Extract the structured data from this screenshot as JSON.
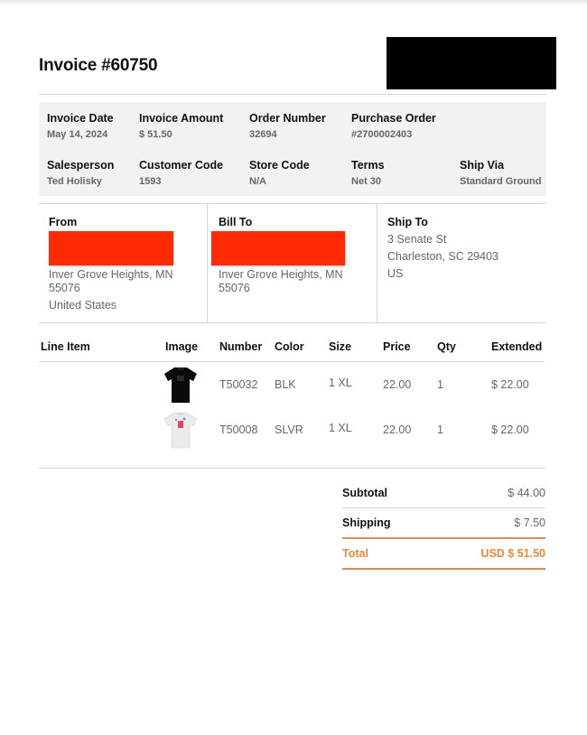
{
  "invoice": {
    "title": "Invoice #60750"
  },
  "meta": {
    "row1": [
      {
        "label": "Invoice Date",
        "value": "May 14, 2024"
      },
      {
        "label": "Invoice Amount",
        "value": "$ 51.50"
      },
      {
        "label": "Order Number",
        "value": "32694"
      },
      {
        "label": "Purchase Order",
        "value": "#2700002403"
      }
    ],
    "row2": [
      {
        "label": "Salesperson",
        "value": "Ted Holisky"
      },
      {
        "label": "Customer Code",
        "value": "1593"
      },
      {
        "label": "Store Code",
        "value": "N/A"
      },
      {
        "label": "Terms",
        "value": "Net 30"
      },
      {
        "label": "Ship Via",
        "value": "Standard Ground"
      }
    ]
  },
  "addresses": {
    "from": {
      "heading": "From",
      "line1": "Inver Grove Heights, MN",
      "line2": "55076",
      "line3": "United States"
    },
    "bill_to": {
      "heading": "Bill To",
      "line1": "Inver Grove Heights, MN",
      "line2": "55076"
    },
    "ship_to": {
      "heading": "Ship To",
      "line1": "3 Senate St",
      "line2": "Charleston, SC 29403",
      "line3": "US"
    }
  },
  "line_items": {
    "headers": [
      "Line Item",
      "Image",
      "Number",
      "Color",
      "Size",
      "Price",
      "Qty",
      "Extended"
    ],
    "rows": [
      {
        "line_item": "",
        "image": "black-tshirt",
        "number": "T50032",
        "color": "BLK",
        "size": "1 XL",
        "price": "22.00",
        "qty": "1",
        "extended": "$ 22.00"
      },
      {
        "line_item": "",
        "image": "white-tshirt",
        "number": "T50008",
        "color": "SLVR",
        "size": "1 XL",
        "price": "22.00",
        "qty": "1",
        "extended": "$ 22.00"
      }
    ]
  },
  "totals": {
    "subtotal_label": "Subtotal",
    "subtotal_value": "$ 44.00",
    "shipping_label": "Shipping",
    "shipping_value": "$ 7.50",
    "total_label": "Total",
    "total_value": "USD $ 51.50"
  },
  "colors": {
    "accent": "#e08a42",
    "redaction": "#ff2a00",
    "meta_background": "#f2f2f2"
  }
}
